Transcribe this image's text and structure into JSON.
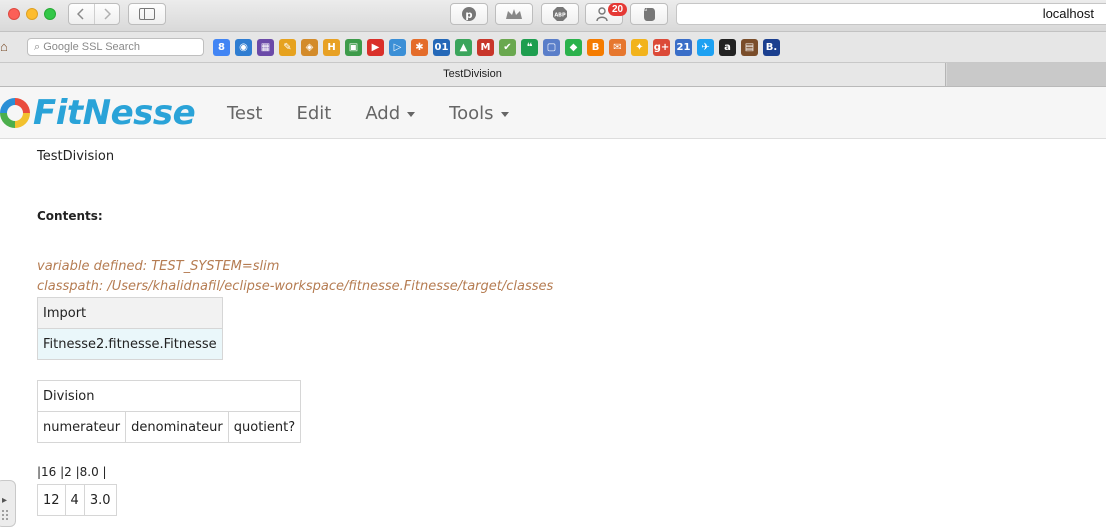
{
  "browser": {
    "url": "localhost",
    "extension_badge_count": "20",
    "search_placeholder": "Google SSL Search",
    "tab_title": "TestDivision",
    "bookmark_icons": [
      {
        "name": "google-icon",
        "glyph": "8",
        "color": "#4285f4"
      },
      {
        "name": "camera-icon",
        "glyph": "◉",
        "color": "#2f7dd1"
      },
      {
        "name": "film-icon",
        "glyph": "▦",
        "color": "#6b4aa8"
      },
      {
        "name": "pencil-icon",
        "glyph": "✎",
        "color": "#e6a21e"
      },
      {
        "name": "note-icon",
        "glyph": "◈",
        "color": "#d38b2a"
      },
      {
        "name": "hackernews-icon",
        "glyph": "H",
        "color": "#e8a124"
      },
      {
        "name": "image-icon",
        "glyph": "▣",
        "color": "#3d9b4a"
      },
      {
        "name": "youtube-icon",
        "glyph": "▶",
        "color": "#d9302a"
      },
      {
        "name": "play-icon",
        "glyph": "▷",
        "color": "#3b8fd6"
      },
      {
        "name": "pinwheel-icon",
        "glyph": "✱",
        "color": "#e46c2a"
      },
      {
        "name": "calendar-icon",
        "glyph": "01",
        "color": "#2468b8"
      },
      {
        "name": "drive-icon",
        "glyph": "▲",
        "color": "#3ba55c"
      },
      {
        "name": "gmail-icon",
        "glyph": "M",
        "color": "#c8362a"
      },
      {
        "name": "check-icon",
        "glyph": "✔",
        "color": "#6aa84f"
      },
      {
        "name": "hangouts-icon",
        "glyph": "❝",
        "color": "#1e9e4f"
      },
      {
        "name": "window-icon",
        "glyph": "▢",
        "color": "#5a7ec9"
      },
      {
        "name": "feedly-icon",
        "glyph": "◆",
        "color": "#2bb24c"
      },
      {
        "name": "blogger-icon",
        "glyph": "B",
        "color": "#f57c00"
      },
      {
        "name": "chat-icon",
        "glyph": "✉",
        "color": "#e6772e"
      },
      {
        "name": "keep-icon",
        "glyph": "✦",
        "color": "#f2b31b"
      },
      {
        "name": "googleplus-icon",
        "glyph": "g+",
        "color": "#dc4a38"
      },
      {
        "name": "calendar21-icon",
        "glyph": "21",
        "color": "#3a6ec8"
      },
      {
        "name": "twitter-icon",
        "glyph": "✈",
        "color": "#1da1f2"
      },
      {
        "name": "amazon-icon",
        "glyph": "a",
        "color": "#222222"
      },
      {
        "name": "shopping-icon",
        "glyph": "▤",
        "color": "#7a4d2a"
      },
      {
        "name": "booking-icon",
        "glyph": "B.",
        "color": "#1b3f8f"
      }
    ]
  },
  "fitnesse": {
    "logo": "FitNesse",
    "menu": [
      {
        "label": "Test",
        "has_caret": false
      },
      {
        "label": "Edit",
        "has_caret": false
      },
      {
        "label": "Add",
        "has_caret": true
      },
      {
        "label": "Tools",
        "has_caret": true
      }
    ]
  },
  "page": {
    "title": "TestDivision",
    "contents_label": "Contents:",
    "variable_line": "variable defined: TEST_SYSTEM=slim",
    "classpath_line": "classpath: /Users/khalidnafil/eclipse-workspace/fitnesse.Fitnesse/target/classes",
    "import_table": {
      "header": "Import",
      "row": "Fitnesse2.fitnesse.Fitnesse"
    },
    "division_table": {
      "header": "Division",
      "columns": [
        "numerateur",
        "denominateur",
        "quotient?"
      ]
    },
    "raw_row": "|16 |2 |8.0 |",
    "data_table": {
      "cells": [
        "12",
        "4",
        "3.0"
      ]
    }
  }
}
